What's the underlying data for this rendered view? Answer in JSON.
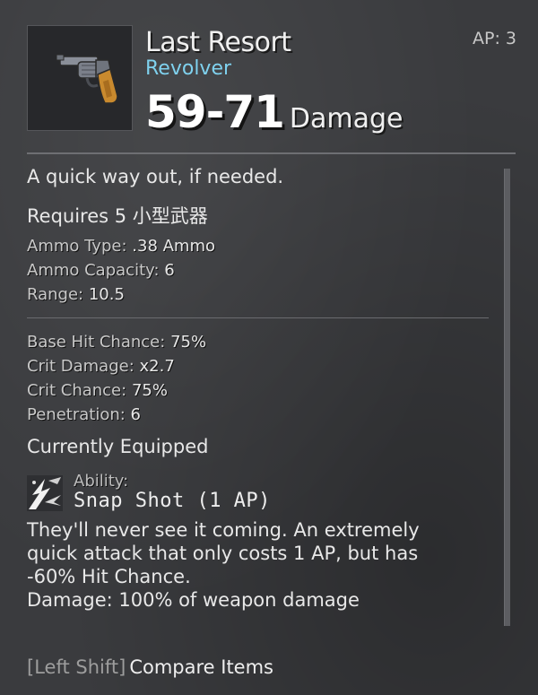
{
  "item": {
    "name": "Last Resort",
    "type": "Revolver",
    "damage_range": "59-71",
    "damage_label": "Damage",
    "ap_cost": "AP: 3",
    "icon": "revolver-icon"
  },
  "description": "A quick way out, if needed.",
  "requirement": "Requires 5 小型武器",
  "stats_group1": [
    {
      "label": "Ammo Type:",
      "value": ".38 Ammo"
    },
    {
      "label": "Ammo Capacity:",
      "value": "6"
    },
    {
      "label": "Range:",
      "value": "10.5"
    }
  ],
  "stats_group2": [
    {
      "label": "Base Hit Chance:",
      "value": "75%"
    },
    {
      "label": "Crit Damage:",
      "value": "x2.7"
    },
    {
      "label": "Crit Chance:",
      "value": "75%"
    },
    {
      "label": "Penetration:",
      "value": "6"
    }
  ],
  "equip_status": "Currently Equipped",
  "ability": {
    "label": "Ability:",
    "name": "Snap Shot (1 AP)",
    "description": "They'll never see it coming. An extremely quick attack that only costs 1 AP, but has -60% Hit Chance.",
    "damage": "Damage: 100% of weapon damage",
    "icon": "snap-shot-icon"
  },
  "footer": {
    "key": "[Left Shift]",
    "action": "Compare Items"
  },
  "colors": {
    "background": "#3a3b3e",
    "item_type": "#7fd1ee",
    "text": "#e8e8e8"
  }
}
